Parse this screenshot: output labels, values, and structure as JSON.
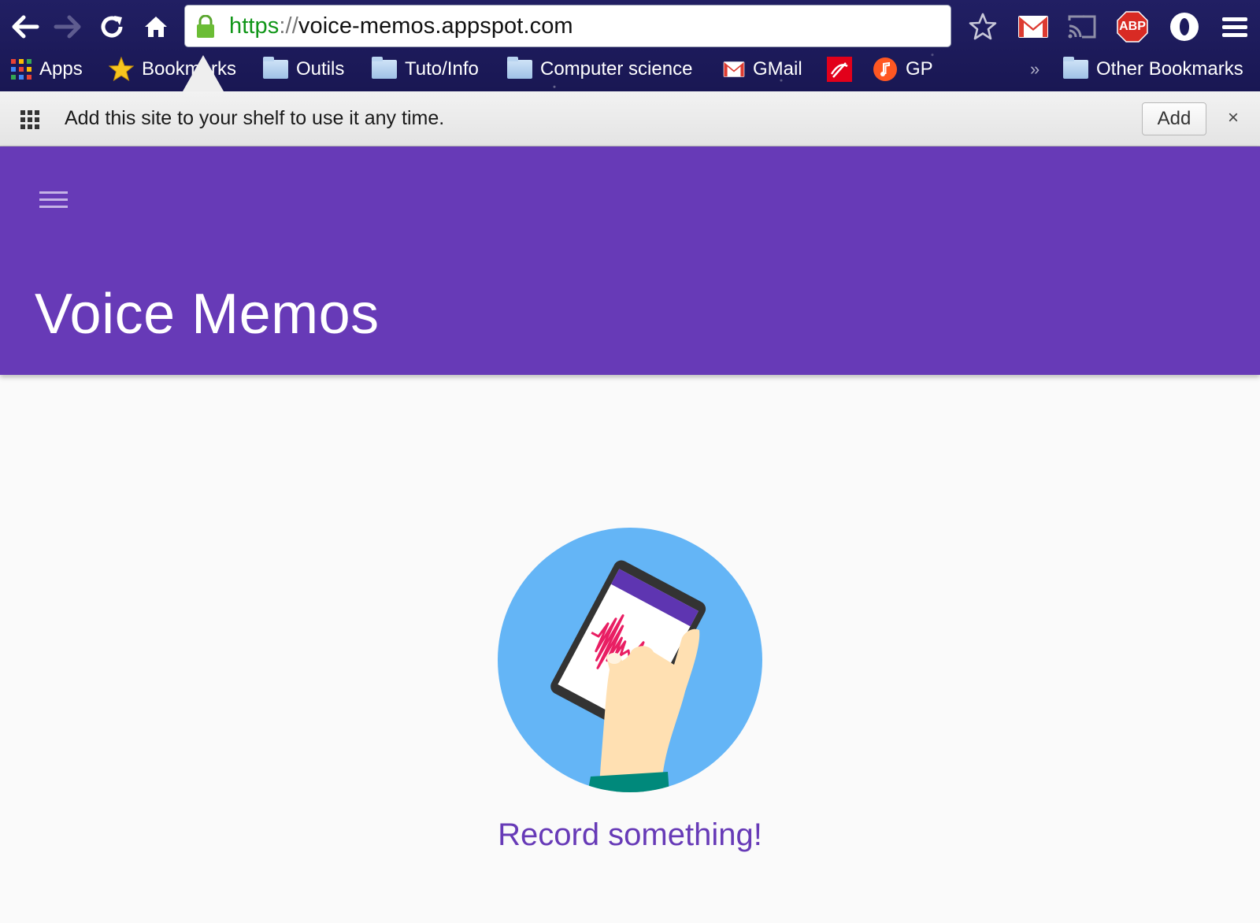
{
  "browser": {
    "url_scheme": "https",
    "url_separator": "://",
    "url_host": "voice-memos.appspot.com",
    "bookmarks": [
      {
        "label": "Apps",
        "icon": "apps-grid-icon"
      },
      {
        "label": "Bookmarks",
        "icon": "star-icon"
      },
      {
        "label": "Outils",
        "icon": "folder-icon"
      },
      {
        "label": "Tuto/Info",
        "icon": "folder-icon"
      },
      {
        "label": "Computer science",
        "icon": "folder-icon"
      },
      {
        "label": "GMail",
        "icon": "gmail-icon"
      },
      {
        "label": "",
        "icon": "red-bank-icon"
      },
      {
        "label": "GP",
        "icon": "music-icon"
      }
    ],
    "overflow": "»",
    "other_bookmarks": "Other Bookmarks",
    "extensions": [
      "star-bookmark-icon",
      "gmail-icon",
      "cast-icon",
      "adblock-plus-icon",
      "opera-icon",
      "menu-icon"
    ],
    "abp_label": "ABP"
  },
  "infobar": {
    "message": "Add this site to your shelf to use it any time.",
    "add_label": "Add",
    "close_label": "×"
  },
  "app": {
    "title": "Voice Memos",
    "empty_message": "Record something!"
  },
  "colors": {
    "primary": "#673ab7",
    "illustration_bg": "#64b5f6",
    "waveform": "#e91e63"
  }
}
